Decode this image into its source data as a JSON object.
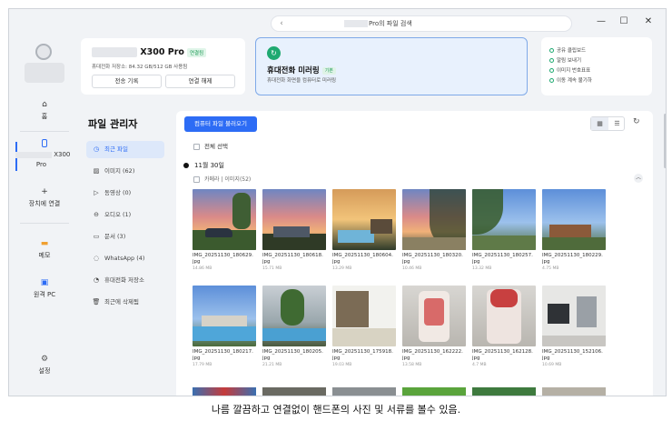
{
  "titlebar": {
    "search_placeholder_visible": "Pro의 파일 검색",
    "back_glyph": "‹",
    "min_glyph": "—",
    "max_glyph": "☐",
    "close_glyph": "✕"
  },
  "leftnav": {
    "home": "홈",
    "device_model": "X300",
    "device_suffix": "Pro",
    "connect": "장치에 연결",
    "memo": "메모",
    "remote_pc": "원격 PC",
    "settings": "설정"
  },
  "device_card": {
    "title": "X300 Pro",
    "badge": "연결됨",
    "storage": "휴대전화 저장소: 84.32 GB/512 GB 사용됨",
    "history_button": "전송 기록",
    "disconnect_button": "연결 해제"
  },
  "mirror_card": {
    "title": "휴대전화 미러링",
    "badge": "기본",
    "subtitle": "휴대전화 화면을 컴퓨터로 미러링"
  },
  "link_card": {
    "items": [
      "공유 클립보드",
      "알림 보내기",
      "이미지 번호표표",
      "이동 계속 불기하"
    ]
  },
  "file_manager": {
    "title": "파일 관리자",
    "items": [
      {
        "label": "최근 파일",
        "icon": "clock-icon"
      },
      {
        "label": "이미지 (62)",
        "icon": "image-icon"
      },
      {
        "label": "동영상 (0)",
        "icon": "video-icon"
      },
      {
        "label": "오디오 (1)",
        "icon": "audio-icon"
      },
      {
        "label": "문서 (3)",
        "icon": "document-icon"
      },
      {
        "label": "WhatsApp (4)",
        "icon": "whatsapp-icon"
      },
      {
        "label": "휴대전화 저장소",
        "icon": "storage-icon"
      },
      {
        "label": "최근에 삭제됨",
        "icon": "trash-icon"
      }
    ]
  },
  "main": {
    "load_button": "컴퓨터 파일 불러오기",
    "select_all": "전체 선택",
    "date_header": "11월 30일",
    "group_header": "카메라 | 이미지(52)",
    "photos": [
      {
        "name": "IMG_20251130_180629.\njpg",
        "size": "14.86 MB",
        "art": "sunset-car"
      },
      {
        "name": "IMG_20251130_180618.\njpg",
        "size": "15.71 MB",
        "art": "sunset-house"
      },
      {
        "name": "IMG_20251130_180604.\njpg",
        "size": "13.29 MB",
        "art": "pool-dusk"
      },
      {
        "name": "IMG_20251130_180320.\njpg",
        "size": "10.46 MB",
        "art": "palm-sunset"
      },
      {
        "name": "IMG_20251130_180257.\njpg",
        "size": "13.32 MB",
        "art": "palm-blue"
      },
      {
        "name": "IMG_20251130_180229.\njpg",
        "size": "4.75 MB",
        "art": "house-blue"
      },
      {
        "name": "IMG_20251130_180217.\njpg",
        "size": "17.79 MB",
        "art": "pool-blue"
      },
      {
        "name": "IMG_20251130_180205.\njpg",
        "size": "21.21 MB",
        "art": "pool-trees"
      },
      {
        "name": "IMG_20251130_175918.\njpg",
        "size": "19.03 MB",
        "art": "beach-hut"
      },
      {
        "name": "IMG_20251130_162222.\njpg",
        "size": "13.58 MB",
        "art": "cup-red"
      },
      {
        "name": "IMG_20251130_162128.\njpg",
        "size": "4.7 MB",
        "art": "cup-red2"
      },
      {
        "name": "IMG_20251130_152106.\njpg",
        "size": "10.69 MB",
        "art": "desk"
      }
    ]
  },
  "caption": "나름 깔끔하고 연결없이 핸드폰의 사진 및 서류를 볼수 있음.",
  "colors": {
    "accent": "#2d6cf5",
    "green": "#1fa971",
    "active_bg": "#dde8fa"
  }
}
